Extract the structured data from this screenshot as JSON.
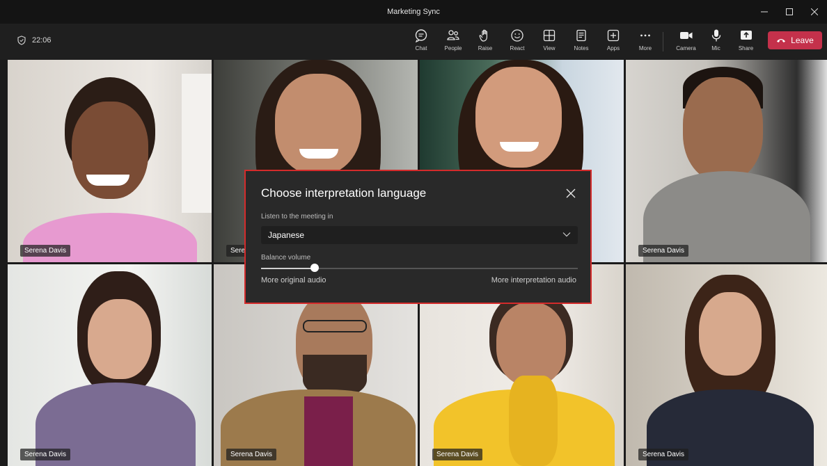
{
  "window": {
    "title": "Marketing Sync"
  },
  "toolbar": {
    "timer": "22:06",
    "tools": [
      {
        "label": "Chat",
        "icon": "chat-icon"
      },
      {
        "label": "People",
        "icon": "people-icon"
      },
      {
        "label": "Raise",
        "icon": "raise-hand-icon"
      },
      {
        "label": "React",
        "icon": "react-icon"
      },
      {
        "label": "View",
        "icon": "view-icon"
      },
      {
        "label": "Notes",
        "icon": "notes-icon"
      },
      {
        "label": "Apps",
        "icon": "apps-icon"
      },
      {
        "label": "More",
        "icon": "more-icon"
      }
    ],
    "media": [
      {
        "label": "Camera",
        "icon": "camera-icon"
      },
      {
        "label": "Mic",
        "icon": "mic-icon"
      },
      {
        "label": "Share",
        "icon": "share-icon"
      }
    ],
    "leave_label": "Leave",
    "leave_color": "#c4314b"
  },
  "participants": [
    {
      "name": "Serena Davis"
    },
    {
      "name": "Serena"
    },
    {
      "name": ""
    },
    {
      "name": "Serena Davis"
    },
    {
      "name": "Serena Davis"
    },
    {
      "name": "Serena Davis"
    },
    {
      "name": "Serena Davis"
    },
    {
      "name": "Serena Davis"
    }
  ],
  "dialog": {
    "title": "Choose interpretation language",
    "listen_label": "Listen to the meeting in",
    "language": "Japanese",
    "balance_label": "Balance volume",
    "balance_value": 0.17,
    "left_label": "More original audio",
    "right_label": "More interpretation audio",
    "highlight_color": "#d42b2b"
  }
}
